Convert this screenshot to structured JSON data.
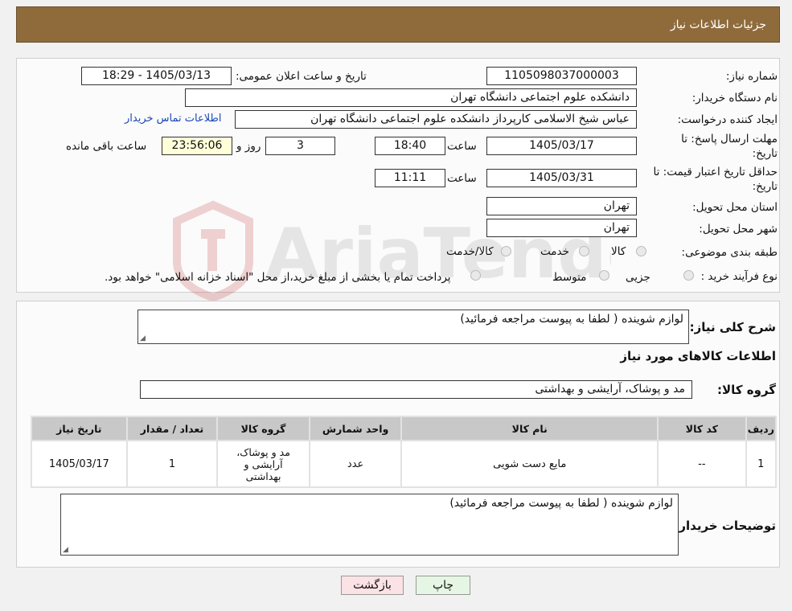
{
  "header": {
    "title": "جزئیات اطلاعات نیاز"
  },
  "form": {
    "need_number_label": "شماره نیاز:",
    "need_number": "1105098037000003",
    "announce_label": "تاریخ و ساعت اعلان عمومی:",
    "announce_value": "1405/03/13 - 18:29",
    "buyer_org_label": "نام دستگاه خریدار:",
    "buyer_org": "دانشکده علوم اجتماعی دانشگاه تهران",
    "creator_label": "ایجاد کننده درخواست:",
    "creator": "عباس شیخ الاسلامی کارپرداز دانشکده علوم اجتماعی دانشگاه تهران",
    "contact_link": "اطلاعات تماس خریدار",
    "deadline_label_1": "مهلت ارسال پاسخ: تا",
    "deadline_label_2": "تاریخ:",
    "deadline_date": "1405/03/17",
    "time_label": "ساعت",
    "deadline_time": "18:40",
    "days_value": "3",
    "days_label": "روز و",
    "remaining_time": "23:56:06",
    "remaining_label": "ساعت باقی مانده",
    "validity_label_1": "حداقل تاریخ اعتبار قیمت: تا",
    "validity_label_2": "تاریخ:",
    "validity_date": "1405/03/31",
    "validity_time": "11:11",
    "province_label": "استان محل تحویل:",
    "province": "تهران",
    "city_label": "شهر محل تحویل:",
    "city": "تهران",
    "category_label": "طبقه بندی موضوعی:",
    "category_options": [
      "کالا",
      "خدمت",
      "کالا/خدمت"
    ],
    "process_label": "نوع فرآیند خرید :",
    "process_options": [
      "جزیی",
      "متوسط"
    ],
    "payment_note": "پرداخت تمام یا بخشی از مبلغ خرید،از محل \"اسناد خزانه اسلامی\" خواهد بود."
  },
  "details": {
    "general_desc_label": "شرح کلی نیاز:",
    "general_desc": "لوازم شوینده ( لطفا به پیوست مراجعه فرمائید)",
    "goods_info_title": "اطلاعات کالاهای مورد نیاز",
    "goods_group_label": "گروه کالا:",
    "goods_group": "مد و پوشاک، آرایشی و بهداشتی",
    "table": {
      "headers": [
        "ردیف",
        "کد کالا",
        "نام کالا",
        "واحد شمارش",
        "گروه کالا",
        "تعداد / مقدار",
        "تاریخ نیاز"
      ],
      "rows": [
        [
          "1",
          "--",
          "مایع دست شویی",
          "عدد",
          "مد و پوشاک، آرایشی و بهداشتی",
          "1",
          "1405/03/17"
        ]
      ]
    },
    "buyer_notes_label": "توضیحات خریدار:",
    "buyer_notes": "لوازم شوینده ( لطفا به پیوست مراجعه فرمائید)"
  },
  "buttons": {
    "print": "چاپ",
    "back": "بازگشت"
  },
  "watermark": {
    "text": "AriaTender.neT"
  }
}
